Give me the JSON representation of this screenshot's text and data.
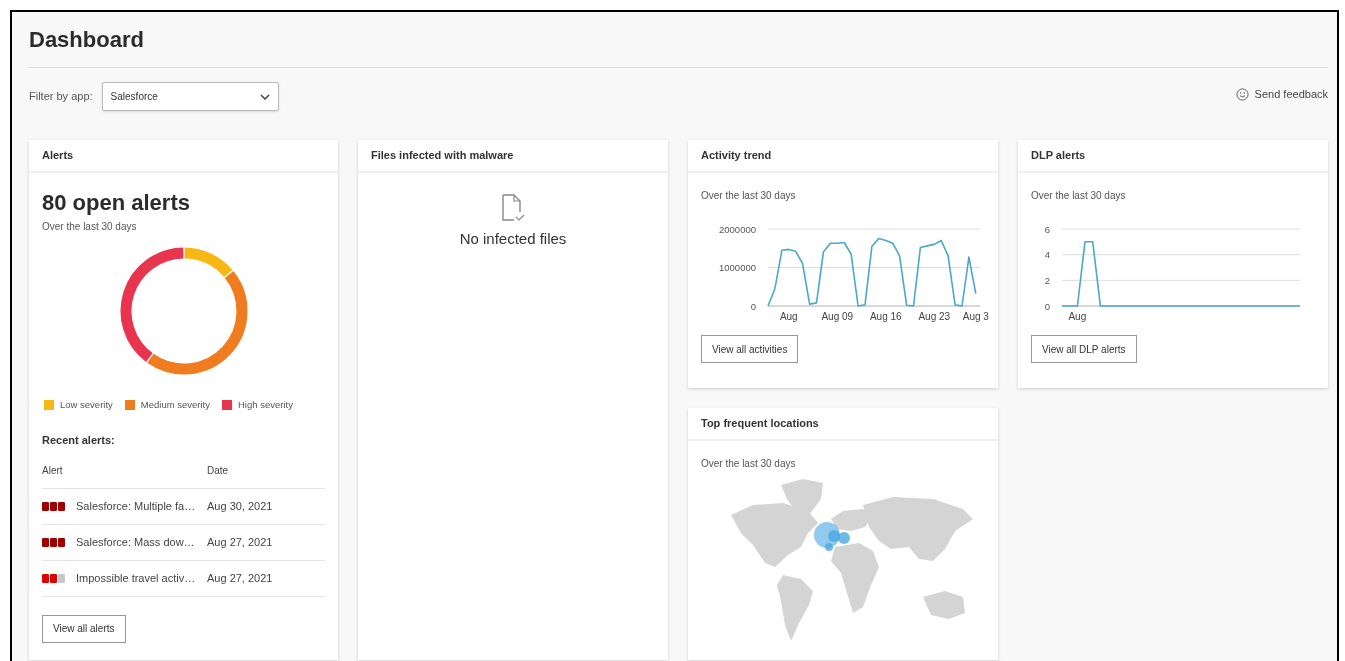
{
  "page": {
    "title": "Dashboard"
  },
  "filter": {
    "label": "Filter by app:",
    "value": "Salesforce"
  },
  "feedback": {
    "label": "Send feedback"
  },
  "alerts_card": {
    "title": "Alerts",
    "headline": "80 open alerts",
    "subtitle": "Over the last 30 days",
    "legend": [
      {
        "label": "Low severity",
        "color": "#f8b814"
      },
      {
        "label": "Medium severity",
        "color": "#f07c20"
      },
      {
        "label": "High severity",
        "color": "#e9344f"
      }
    ],
    "recent_title": "Recent alerts:",
    "columns": [
      "Alert",
      "Date"
    ],
    "rows": [
      {
        "alert": "Salesforce: Multiple fa…",
        "date": "Aug 30, 2021",
        "kind": "high"
      },
      {
        "alert": "Salesforce: Mass dow…",
        "date": "Aug 27, 2021",
        "kind": "high"
      },
      {
        "alert": "Impossible travel activ…",
        "date": "Aug 27, 2021",
        "kind": "medium"
      }
    ],
    "button": "View all alerts"
  },
  "malware_card": {
    "title": "Files infected with malware",
    "message": "No infected files"
  },
  "activity_card": {
    "title": "Activity trend",
    "subtitle": "Over the last 30 days",
    "button": "View all activities",
    "chart_data": {
      "type": "line",
      "categories": [
        null,
        null,
        null,
        "Aug",
        null,
        null,
        null,
        null,
        null,
        null,
        "Aug 09",
        null,
        null,
        null,
        null,
        null,
        null,
        "Aug 16",
        null,
        null,
        null,
        null,
        null,
        null,
        "Aug 23",
        null,
        null,
        null,
        null,
        null,
        "Aug 3"
      ],
      "series": [
        {
          "color": "#4aa8c8",
          "values": [
            0,
            450000,
            1450000,
            1470000,
            1420000,
            1100000,
            50000,
            80000,
            1400000,
            1630000,
            1630000,
            1650000,
            1350000,
            0,
            30000,
            1550000,
            1750000,
            1700000,
            1630000,
            1300000,
            20000,
            0,
            1520000,
            1560000,
            1600000,
            1700000,
            1300000,
            30000,
            0,
            1270000,
            320000
          ]
        }
      ],
      "ylim": [
        0,
        2000000
      ],
      "yticks": [
        0,
        1000000,
        2000000
      ]
    }
  },
  "dlp_card": {
    "title": "DLP alerts",
    "subtitle": "Over the last 30 days",
    "button": "View all DLP alerts",
    "chart_data": {
      "type": "line",
      "categories": [
        null,
        null,
        "Aug",
        null,
        null,
        null,
        null,
        null,
        null,
        null,
        null,
        null,
        null,
        null,
        null,
        null,
        null,
        null,
        null,
        null,
        null,
        null,
        null,
        null,
        null,
        null,
        null,
        null,
        null,
        null,
        null,
        null
      ],
      "series": [
        {
          "color": "#4aa8c8",
          "values": [
            0,
            0,
            0,
            5,
            5,
            0,
            0,
            0,
            0,
            0,
            0,
            0,
            0,
            0,
            0,
            0,
            0,
            0,
            0,
            0,
            0,
            0,
            0,
            0,
            0,
            0,
            0,
            0,
            0,
            0,
            0,
            0
          ]
        }
      ],
      "ylim": [
        0,
        6
      ],
      "yticks": [
        0,
        2,
        4,
        6
      ]
    }
  },
  "locations_card": {
    "title": "Top frequent locations",
    "subtitle": "Over the last 30 days"
  }
}
